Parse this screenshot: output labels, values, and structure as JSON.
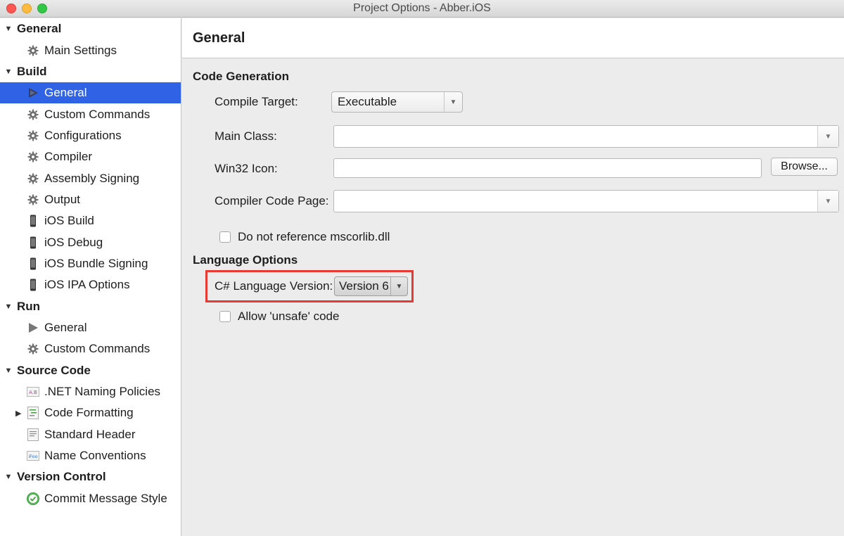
{
  "window": {
    "title": "Project Options - Abber.iOS"
  },
  "sidebar": {
    "sections": [
      {
        "label": "General",
        "items": [
          {
            "label": "Main Settings",
            "icon": "gear-icon"
          }
        ]
      },
      {
        "label": "Build",
        "items": [
          {
            "label": "General",
            "icon": "play-icon",
            "selected": true
          },
          {
            "label": "Custom Commands",
            "icon": "gear-icon"
          },
          {
            "label": "Configurations",
            "icon": "gear-icon"
          },
          {
            "label": "Compiler",
            "icon": "gear-icon"
          },
          {
            "label": "Assembly Signing",
            "icon": "gear-icon"
          },
          {
            "label": "Output",
            "icon": "gear-icon"
          },
          {
            "label": "iOS Build",
            "icon": "phone-icon"
          },
          {
            "label": "iOS Debug",
            "icon": "phone-icon"
          },
          {
            "label": "iOS Bundle Signing",
            "icon": "phone-icon"
          },
          {
            "label": "iOS IPA Options",
            "icon": "phone-icon"
          }
        ]
      },
      {
        "label": "Run",
        "items": [
          {
            "label": "General",
            "icon": "play-icon"
          },
          {
            "label": "Custom Commands",
            "icon": "gear-icon"
          }
        ]
      },
      {
        "label": "Source Code",
        "items": [
          {
            "label": ".NET Naming Policies",
            "icon": "naming-policy-icon"
          },
          {
            "label": "Code Formatting",
            "icon": "code-format-icon",
            "expandable": true
          },
          {
            "label": "Standard Header",
            "icon": "document-icon"
          },
          {
            "label": "Name Conventions",
            "icon": "name-convention-icon"
          }
        ]
      },
      {
        "label": "Version Control",
        "items": [
          {
            "label": "Commit Message Style",
            "icon": "check-circle-icon"
          }
        ]
      }
    ]
  },
  "main": {
    "title": "General",
    "code_generation": {
      "title": "Code Generation",
      "compile_target_label": "Compile Target:",
      "compile_target_value": "Executable",
      "main_class_label": "Main Class:",
      "main_class_value": "",
      "win32_icon_label": "Win32 Icon:",
      "win32_icon_value": "",
      "browse_label": "Browse...",
      "code_page_label": "Compiler Code Page:",
      "code_page_value": "",
      "no_mscorlib_label": "Do not reference mscorlib.dll"
    },
    "language_options": {
      "title": "Language Options",
      "version_label": "C# Language Version:",
      "version_value": "Version 6",
      "unsafe_label": "Allow 'unsafe' code"
    }
  },
  "colors": {
    "selection": "#2f62e4",
    "highlight_box": "#e53b34"
  }
}
